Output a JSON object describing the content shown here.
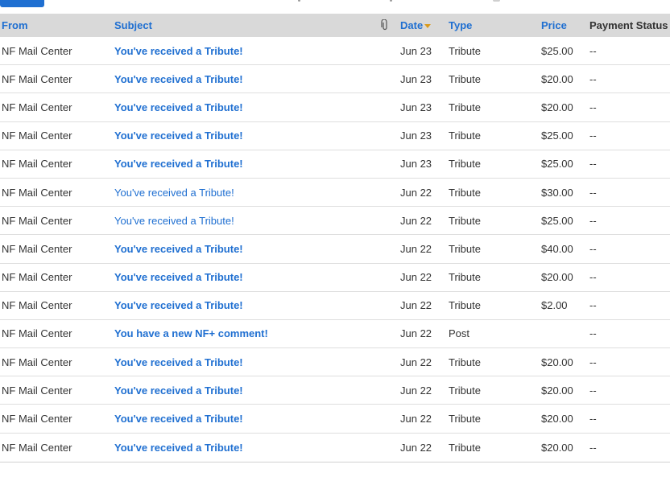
{
  "header": {
    "from": "From",
    "subject": "Subject",
    "attachment_icon": "paperclip-icon",
    "date": "Date",
    "type": "Type",
    "price": "Price",
    "payment_status": "Payment Status"
  },
  "colors": {
    "link": "#1f6fd1",
    "header_bg": "#d9d9d9",
    "sort_arrow": "#d99a1c",
    "text": "#333333"
  },
  "messages": [
    {
      "from": "NF Mail Center",
      "subject": "You've received a Tribute!",
      "unread": true,
      "date": "Jun 23",
      "type": "Tribute",
      "price": "$25.00",
      "status": "--"
    },
    {
      "from": "NF Mail Center",
      "subject": "You've received a Tribute!",
      "unread": true,
      "date": "Jun 23",
      "type": "Tribute",
      "price": "$20.00",
      "status": "--"
    },
    {
      "from": "NF Mail Center",
      "subject": "You've received a Tribute!",
      "unread": true,
      "date": "Jun 23",
      "type": "Tribute",
      "price": "$20.00",
      "status": "--"
    },
    {
      "from": "NF Mail Center",
      "subject": "You've received a Tribute!",
      "unread": true,
      "date": "Jun 23",
      "type": "Tribute",
      "price": "$25.00",
      "status": "--"
    },
    {
      "from": "NF Mail Center",
      "subject": "You've received a Tribute!",
      "unread": true,
      "date": "Jun 23",
      "type": "Tribute",
      "price": "$25.00",
      "status": "--"
    },
    {
      "from": "NF Mail Center",
      "subject": "You've received a Tribute!",
      "unread": false,
      "date": "Jun 22",
      "type": "Tribute",
      "price": "$30.00",
      "status": "--"
    },
    {
      "from": "NF Mail Center",
      "subject": "You've received a Tribute!",
      "unread": false,
      "date": "Jun 22",
      "type": "Tribute",
      "price": "$25.00",
      "status": "--"
    },
    {
      "from": "NF Mail Center",
      "subject": "You've received a Tribute!",
      "unread": true,
      "date": "Jun 22",
      "type": "Tribute",
      "price": "$40.00",
      "status": "--"
    },
    {
      "from": "NF Mail Center",
      "subject": "You've received a Tribute!",
      "unread": true,
      "date": "Jun 22",
      "type": "Tribute",
      "price": "$20.00",
      "status": "--"
    },
    {
      "from": "NF Mail Center",
      "subject": "You've received a Tribute!",
      "unread": true,
      "date": "Jun 22",
      "type": "Tribute",
      "price": "$2.00",
      "status": "--"
    },
    {
      "from": "NF Mail Center",
      "subject": "You have a new NF+ comment!",
      "unread": true,
      "date": "Jun 22",
      "type": "Post",
      "price": "",
      "status": "--"
    },
    {
      "from": "NF Mail Center",
      "subject": "You've received a Tribute!",
      "unread": true,
      "date": "Jun 22",
      "type": "Tribute",
      "price": "$20.00",
      "status": "--"
    },
    {
      "from": "NF Mail Center",
      "subject": "You've received a Tribute!",
      "unread": true,
      "date": "Jun 22",
      "type": "Tribute",
      "price": "$20.00",
      "status": "--"
    },
    {
      "from": "NF Mail Center",
      "subject": "You've received a Tribute!",
      "unread": true,
      "date": "Jun 22",
      "type": "Tribute",
      "price": "$20.00",
      "status": "--"
    },
    {
      "from": "NF Mail Center",
      "subject": "You've received a Tribute!",
      "unread": true,
      "date": "Jun 22",
      "type": "Tribute",
      "price": "$20.00",
      "status": "--"
    }
  ]
}
